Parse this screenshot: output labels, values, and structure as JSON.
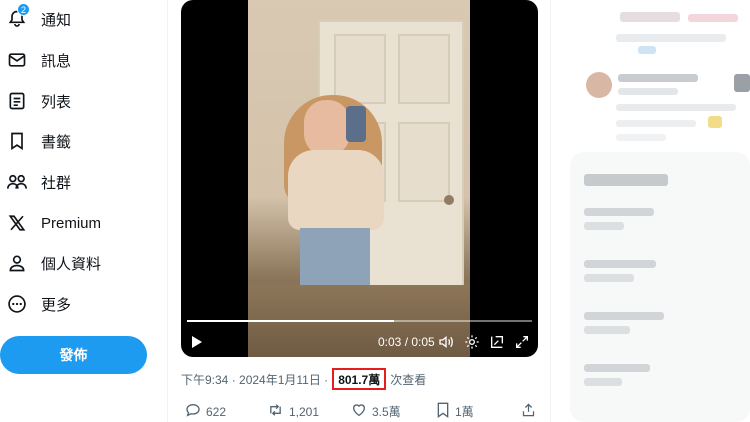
{
  "nav": {
    "items": [
      {
        "label": "通知",
        "icon": "bell-icon",
        "badge": "2"
      },
      {
        "label": "訊息",
        "icon": "envelope-icon"
      },
      {
        "label": "列表",
        "icon": "list-icon"
      },
      {
        "label": "書籤",
        "icon": "bookmark-icon"
      },
      {
        "label": "社群",
        "icon": "people-icon"
      },
      {
        "label": "Premium",
        "icon": "x-logo-icon"
      },
      {
        "label": "個人資料",
        "icon": "person-icon"
      },
      {
        "label": "更多",
        "icon": "more-circle-icon"
      }
    ],
    "post_button": "發佈"
  },
  "video": {
    "time": "0:03 / 0:05",
    "progress": 0.6
  },
  "meta": {
    "timestamp": "下午9:34 · 2024年1月11日 · ",
    "views_count": "801.7萬",
    "views_label": "次查看"
  },
  "actions": {
    "replies": "622",
    "reposts": "1,201",
    "likes": "3.5萬",
    "bookmarks": "1萬"
  },
  "colors": {
    "accent": "#1d9bf0",
    "highlight_box": "#e41e1e",
    "secondary_text": "#536471"
  }
}
